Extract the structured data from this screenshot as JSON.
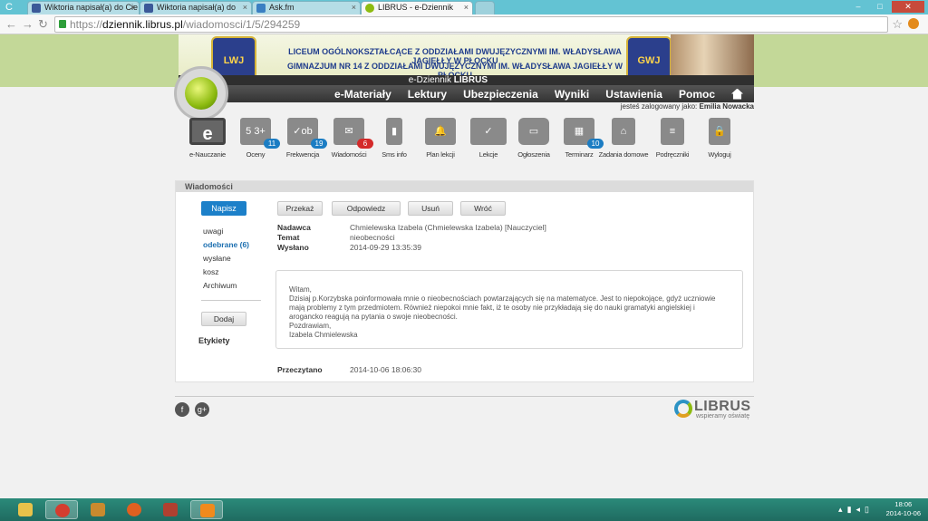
{
  "browser": {
    "tabs": [
      {
        "title": "Wiktoria napisał(a) do Cie",
        "active": false
      },
      {
        "title": "Wiktoria napisał(a) do",
        "active": false
      },
      {
        "title": "Ask.fm",
        "active": false
      },
      {
        "title": "LIBRUS - e-Dziennik",
        "active": true
      }
    ],
    "url_prefix": "https://",
    "url_domain": "dziennik.librus.pl",
    "url_path": "/wiadomosci/1/5/294259",
    "colors": {
      "tabbar": "#63c3d3",
      "lock": "#2e9e3a"
    }
  },
  "header": {
    "school_line1": "LICEUM OGÓLNOKSZTAŁCĄCE Z ODDZIAŁAMI DWUJĘZYCZNYMI IM. WŁADYSŁAWA JAGIEŁŁY W PŁOCKU",
    "school_line2": "GIMNAZJUM NR 14 Z ODDZIAŁAMI DWUJĘZYCZNYMI IM. WŁADYSŁAWA JAGIEŁŁY W PŁOCKU",
    "crest_left": "LWJ",
    "crest_right": "GWJ",
    "app_name_prefix": "e-Dziennik",
    "app_name_brand": "LIBRUS",
    "nav": [
      "e-Materiały",
      "Lektury",
      "Ubezpieczenia",
      "Wyniki",
      "Ustawienia",
      "Pomoc"
    ],
    "logged_in_label": "jesteś zalogowany jako:",
    "logged_in_user": "Emilia Nowacka"
  },
  "icons": [
    {
      "label": "e-Nauczanie",
      "glyph": "e",
      "badge": ""
    },
    {
      "label": "Oceny",
      "glyph": "5 3+",
      "badge": "11",
      "badge_color": "blue"
    },
    {
      "label": "Frekwencja",
      "glyph": "✓ob",
      "badge": "19",
      "badge_color": "blue"
    },
    {
      "label": "Wiadomości",
      "glyph": "✉",
      "badge": "6",
      "badge_color": "red"
    },
    {
      "label": "Sms info",
      "glyph": "▮",
      "badge": ""
    },
    {
      "label": "Plan lekcji",
      "glyph": "🔔",
      "badge": ""
    },
    {
      "label": "Lekcje",
      "glyph": "✓",
      "badge": ""
    },
    {
      "label": "Ogłoszenia",
      "glyph": "▭",
      "badge": ""
    },
    {
      "label": "Terminarz",
      "glyph": "▦",
      "badge": "10",
      "badge_color": "blue"
    },
    {
      "label": "Zadania domowe",
      "glyph": "⌂",
      "badge": ""
    },
    {
      "label": "Podręczniki",
      "glyph": "≡",
      "badge": ""
    },
    {
      "label": "Wyloguj",
      "glyph": "🔒",
      "badge": ""
    }
  ],
  "messages": {
    "panel_title": "Wiadomości",
    "compose_label": "Napisz",
    "folders": [
      {
        "label": "uwagi",
        "active": false
      },
      {
        "label": "odebrane (6)",
        "active": true
      },
      {
        "label": "wysłane",
        "active": false
      },
      {
        "label": "kosz",
        "active": false
      },
      {
        "label": "Archiwum",
        "active": false
      }
    ],
    "add_label": "Dodaj",
    "labels_title": "Etykiety",
    "actions": [
      "Przekaż",
      "Odpowiedz",
      "Usuń",
      "Wróć"
    ],
    "sender_label": "Nadawca",
    "sender": "Chmielewska Izabela (Chmielewska Izabela) [Nauczyciel]",
    "subject_label": "Temat",
    "subject": "nieobecności",
    "sent_label": "Wysłano",
    "sent": "2014-09-29 13:35:39",
    "body": [
      "Witam,",
      "Dzisiaj p.Korzybska poinformowała mnie o nieobecnościach powtarzających się na matematyce. Jest to niepokojące, gdyż uczniowie mają problemy z tym przedmiotem. Również niepokoi mnie fakt, iż te osoby nie przykładają się do nauki gramatyki angielskiej i arogancko reagują na pytania o swoje nieobecności.",
      "Pozdrawiam,",
      "Izabela Chmielewska"
    ],
    "read_label": "Przeczytano",
    "read": "2014-10-06 18:06:30"
  },
  "footer": {
    "brand": "LIBRUS",
    "tagline": "wspieramy oświatę"
  },
  "taskbar": {
    "time": "18:06",
    "date": "2014-10-06"
  }
}
